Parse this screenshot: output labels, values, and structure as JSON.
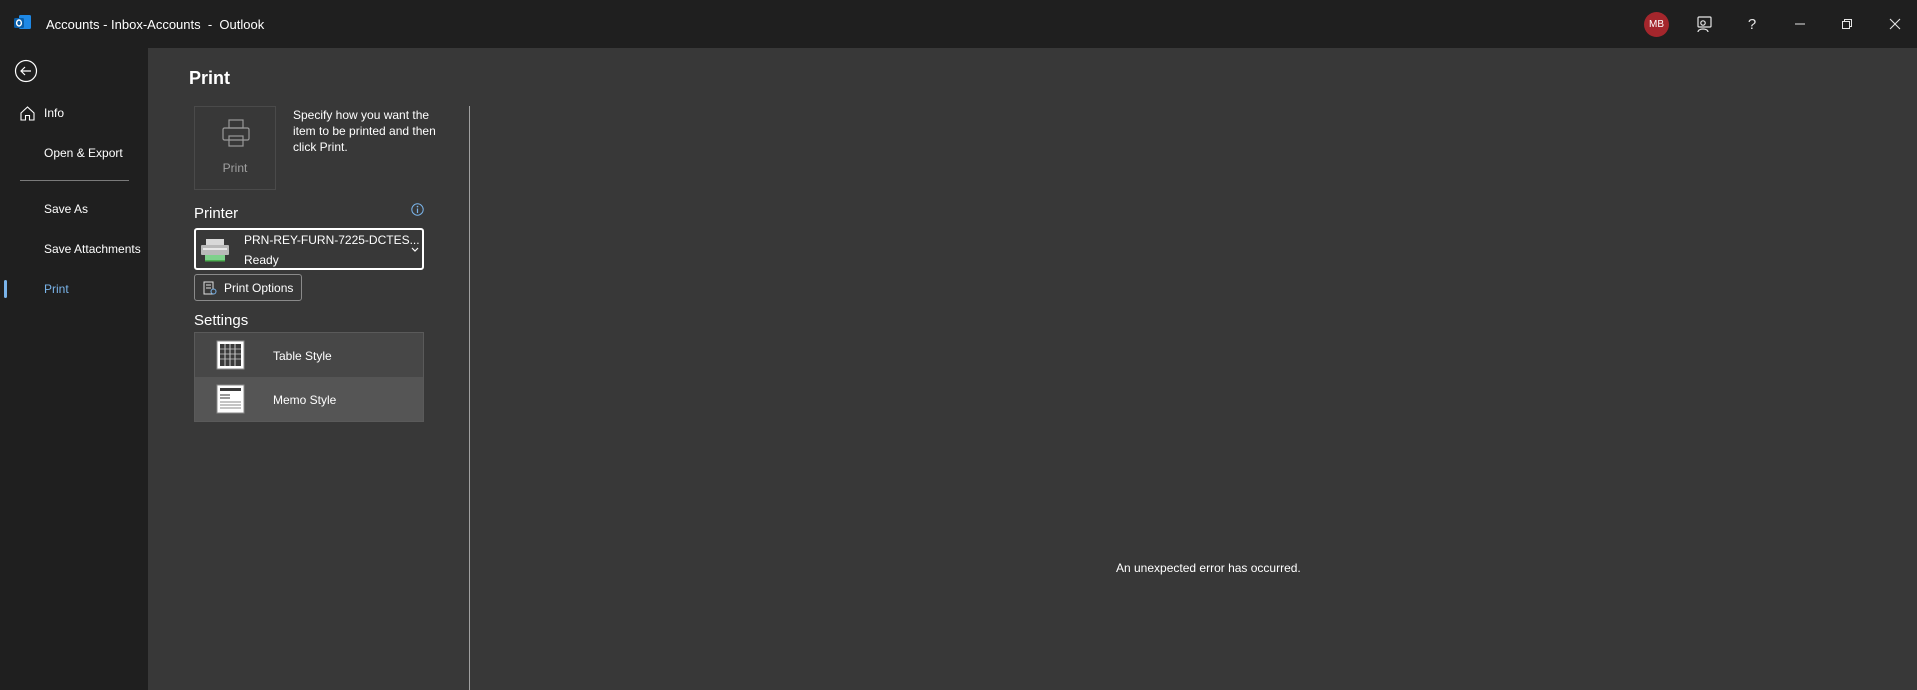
{
  "window": {
    "title": "Accounts - Inbox-Accounts  -  Outlook",
    "avatar_initials": "MB",
    "help_label": "?",
    "icons": [
      "outlook-logo-icon",
      "feedback-icon",
      "help-icon",
      "minimize-icon",
      "restore-icon",
      "close-icon"
    ]
  },
  "nav": {
    "back_icon": "back-arrow-icon",
    "items": [
      {
        "label": "Info",
        "icon": "home-icon"
      },
      {
        "label": "Open & Export"
      },
      {
        "label": "Save As"
      },
      {
        "label": "Save Attachments"
      },
      {
        "label": "Print",
        "active": true
      }
    ]
  },
  "main": {
    "title": "Print",
    "print_button_label": "Print",
    "description": "Specify how you want the item to be printed and then click Print.",
    "printer_section": "Printer",
    "printer": {
      "name": "PRN-REY-FURN-7225-DCTES...",
      "status": "Ready"
    },
    "print_options_label": "Print Options",
    "settings_section": "Settings",
    "styles": [
      {
        "label": "Table Style",
        "icon": "table-style-icon"
      },
      {
        "label": "Memo Style",
        "icon": "memo-style-icon"
      }
    ],
    "preview_message": "An unexpected error has occurred."
  },
  "colors": {
    "titlebar_bg": "#1f1f1f",
    "main_bg": "#383838",
    "accent": "#7ab4ea",
    "avatar_bg": "#a4262c"
  }
}
